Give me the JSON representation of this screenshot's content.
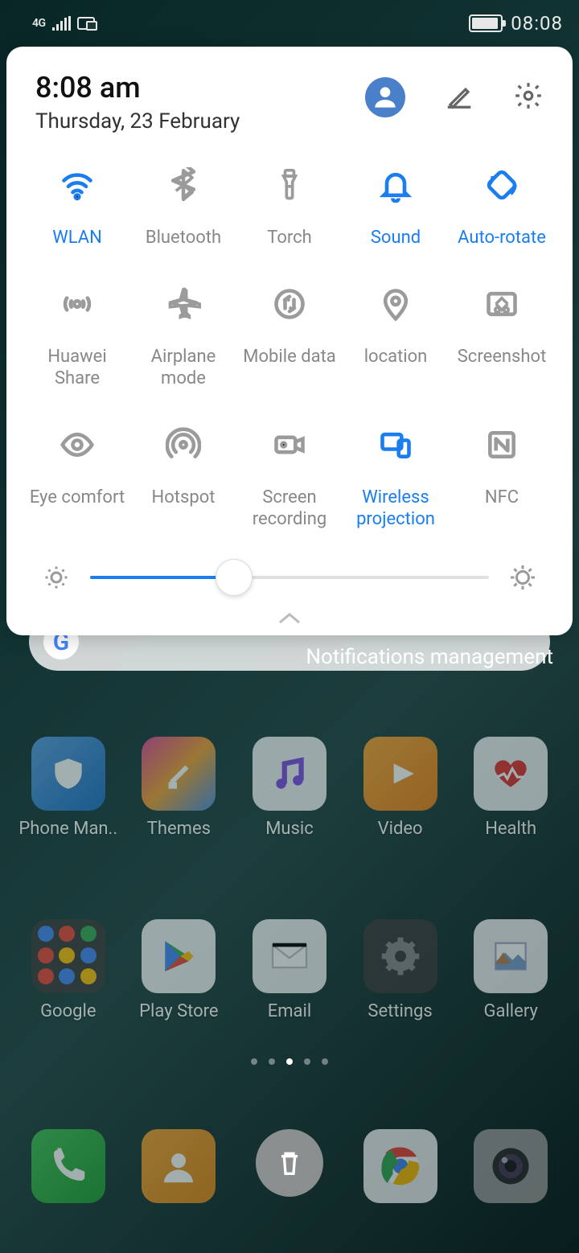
{
  "status_bar": {
    "network_badge": "4G",
    "time": "08:08"
  },
  "qs": {
    "header": {
      "time": "8:08 am",
      "date": "Thursday, 23 February"
    },
    "tiles": [
      {
        "id": "wlan",
        "label": "WLAN",
        "active": true,
        "icon": "wifi-icon"
      },
      {
        "id": "bluetooth",
        "label": "Bluetooth",
        "active": false,
        "icon": "bluetooth-icon"
      },
      {
        "id": "torch",
        "label": "Torch",
        "active": false,
        "icon": "flashlight-icon"
      },
      {
        "id": "sound",
        "label": "Sound",
        "active": true,
        "icon": "bell-icon"
      },
      {
        "id": "autorotate",
        "label": "Auto-rotate",
        "active": true,
        "icon": "rotate-icon"
      },
      {
        "id": "huaweishare",
        "label": "Huawei Share",
        "active": false,
        "icon": "share-waves-icon"
      },
      {
        "id": "airplane",
        "label": "Airplane mode",
        "active": false,
        "icon": "airplane-icon"
      },
      {
        "id": "mobiledata",
        "label": "Mobile data",
        "active": false,
        "icon": "mobile-data-icon"
      },
      {
        "id": "location",
        "label": "location",
        "active": false,
        "icon": "location-icon"
      },
      {
        "id": "screenshot",
        "label": "Screenshot",
        "active": false,
        "icon": "scissors-icon"
      },
      {
        "id": "eyecomfort",
        "label": "Eye comfort",
        "active": false,
        "icon": "eye-icon"
      },
      {
        "id": "hotspot",
        "label": "Hotspot",
        "active": false,
        "icon": "hotspot-icon"
      },
      {
        "id": "screenrec",
        "label": "Screen recording",
        "active": false,
        "icon": "camcorder-icon"
      },
      {
        "id": "wirelessproj",
        "label": "Wireless projection",
        "active": true,
        "icon": "cast-icon"
      },
      {
        "id": "nfc",
        "label": "NFC",
        "active": false,
        "icon": "nfc-icon"
      }
    ],
    "brightness_percent": 36
  },
  "notifications_mgmt_label": "Notifications management",
  "home": {
    "apps_row1": [
      {
        "label": "Phone Man..",
        "icon": "shield-icon",
        "bg": "bg-blue-grad"
      },
      {
        "label": "Themes",
        "icon": "brush-icon",
        "bg": "bg-rainbow"
      },
      {
        "label": "Music",
        "icon": "music-icon",
        "bg": "bg-white"
      },
      {
        "label": "Video",
        "icon": "play-icon",
        "bg": "bg-orange"
      },
      {
        "label": "Health",
        "icon": "heart-icon",
        "bg": "bg-white"
      }
    ],
    "apps_row2": [
      {
        "label": "Google",
        "icon": "folder-icon",
        "bg": "bg-dark"
      },
      {
        "label": "Play Store",
        "icon": "playstore-icon",
        "bg": "bg-white"
      },
      {
        "label": "Email",
        "icon": "envelope-icon",
        "bg": "bg-white"
      },
      {
        "label": "Settings",
        "icon": "gear-icon",
        "bg": "bg-dark"
      },
      {
        "label": "Gallery",
        "icon": "gallery-icon",
        "bg": "bg-white"
      }
    ],
    "dock": [
      {
        "label": "Phone",
        "icon": "phone-icon",
        "bg": "bg-green"
      },
      {
        "label": "Contacts",
        "icon": "contact-icon",
        "bg": "bg-orange2"
      },
      {
        "label": "Trash",
        "icon": "trash-icon",
        "bg": "trash"
      },
      {
        "label": "Chrome",
        "icon": "chrome-icon",
        "bg": "bg-white"
      },
      {
        "label": "Camera",
        "icon": "camera-icon",
        "bg": "bg-gray"
      }
    ]
  }
}
